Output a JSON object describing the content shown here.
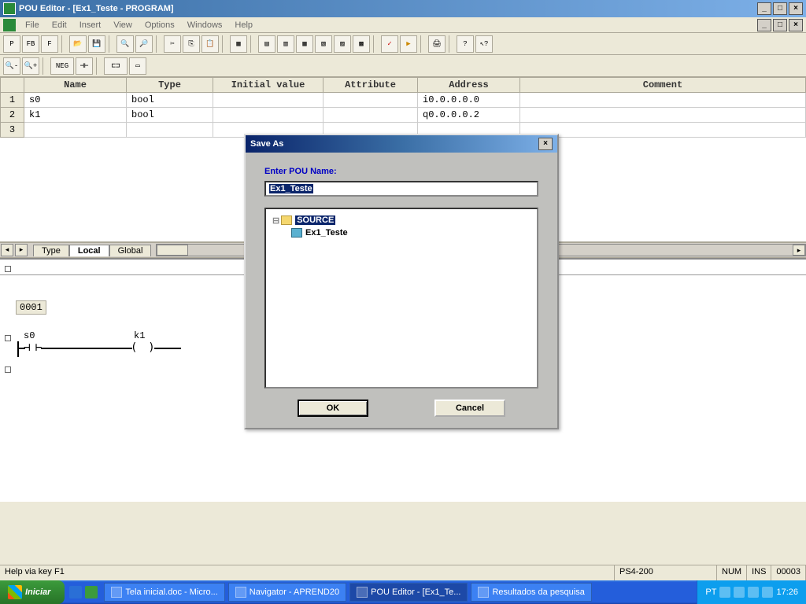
{
  "titlebar": {
    "text": "POU Editor - [Ex1_Teste - PROGRAM]"
  },
  "menubar": {
    "items": [
      "File",
      "Edit",
      "Insert",
      "View",
      "Options",
      "Windows",
      "Help"
    ]
  },
  "grid": {
    "headers": [
      "Name",
      "Type",
      "Initial value",
      "Attribute",
      "Address",
      "Comment"
    ],
    "rows": [
      {
        "num": "1",
        "name": "s0",
        "type": "bool",
        "initial": "",
        "attr": "",
        "addr": "i0.0.0.0.0",
        "comment": ""
      },
      {
        "num": "2",
        "name": "k1",
        "type": "bool",
        "initial": "",
        "attr": "",
        "addr": "q0.0.0.0.2",
        "comment": ""
      },
      {
        "num": "3",
        "name": "",
        "type": "",
        "initial": "",
        "attr": "",
        "addr": "",
        "comment": ""
      }
    ]
  },
  "sheets": {
    "tab1": "Type",
    "tab2": "Local",
    "tab3": "Global"
  },
  "ladder": {
    "rung_num": "0001",
    "contact_label": "s0",
    "coil_label": "k1"
  },
  "statusbar": {
    "help": "Help via key F1",
    "device": "PS4-200",
    "num": "NUM",
    "ins": "INS",
    "count": "00003"
  },
  "dialog": {
    "title": "Save As",
    "prompt": "Enter POU Name:",
    "input_value": "Ex1_Teste",
    "tree": {
      "root": "SOURCE",
      "child": "Ex1_Teste"
    },
    "ok": "OK",
    "cancel": "Cancel"
  },
  "taskbar": {
    "start": "Iniciar",
    "items": [
      "Tela inicial.doc - Micro...",
      "Navigator - APREND20",
      "POU Editor - [Ex1_Te...",
      "Resultados da pesquisa"
    ],
    "lang": "PT",
    "clock": "17:26"
  }
}
